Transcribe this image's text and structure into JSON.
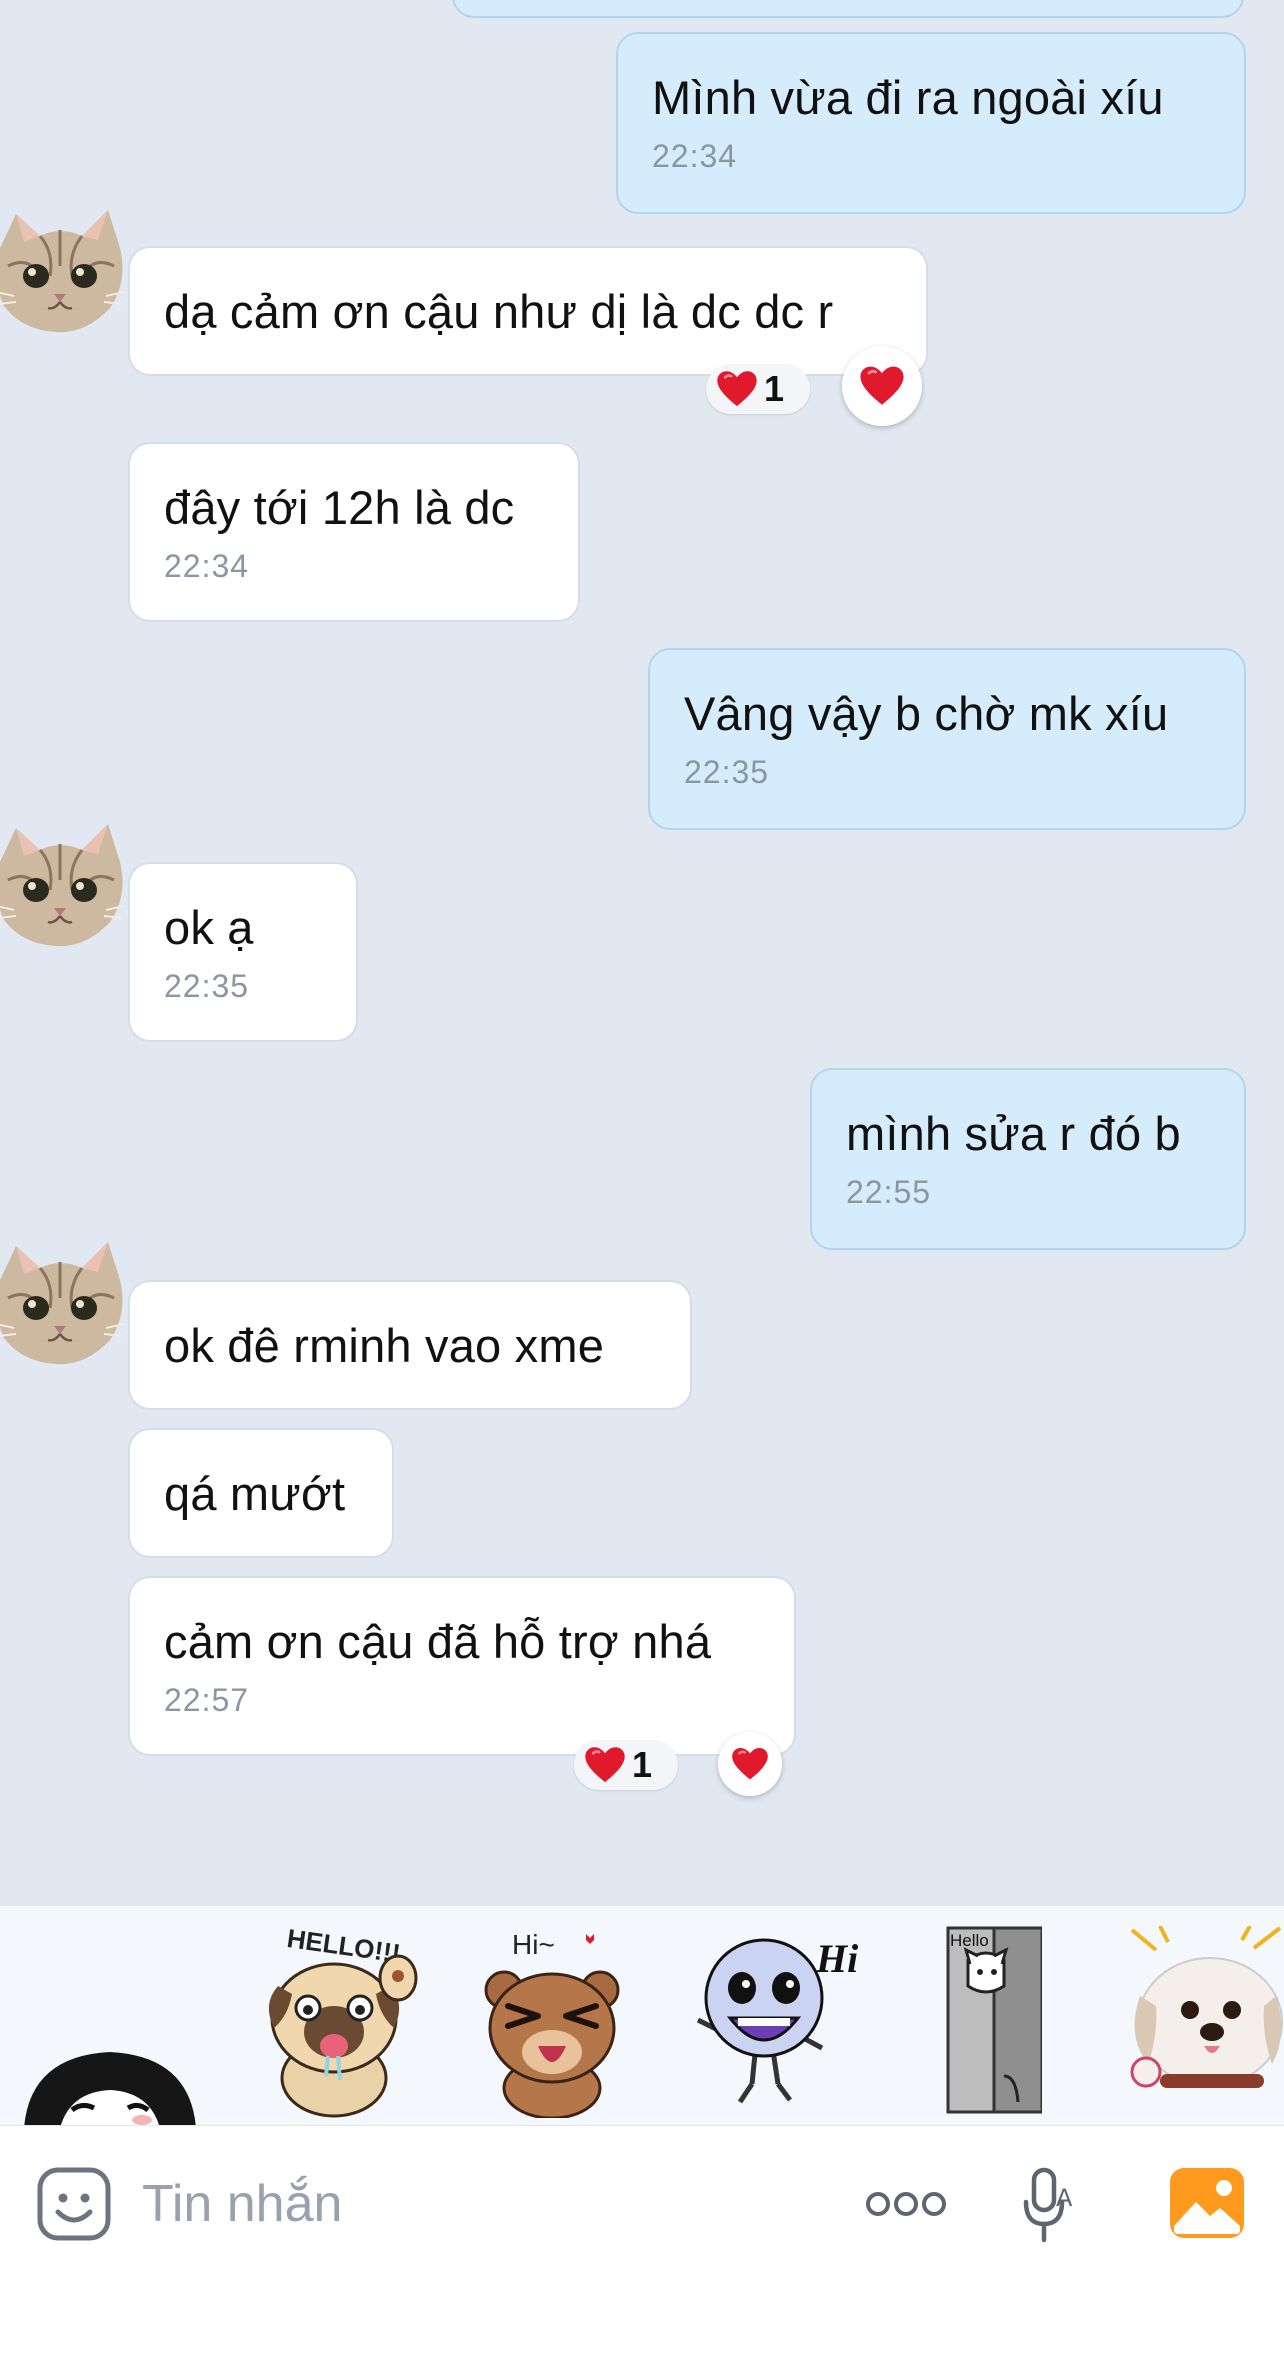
{
  "messages": [
    {
      "id": "m1",
      "side": "out",
      "text": "Mình vừa đi ra ngoài xíu",
      "time": "22:34"
    },
    {
      "id": "m2",
      "side": "in",
      "text": "dạ cảm ơn cậu như dị là dc dc r",
      "reaction": {
        "emoji": "heart",
        "count": "1"
      }
    },
    {
      "id": "m3",
      "side": "in",
      "text": "đây tới 12h là dc",
      "time": "22:34"
    },
    {
      "id": "m4",
      "side": "out",
      "text": "Vâng vậy b chờ mk xíu",
      "time": "22:35"
    },
    {
      "id": "m5",
      "side": "in",
      "text": "ok ạ",
      "time": "22:35"
    },
    {
      "id": "m6",
      "side": "out",
      "text": "mình sửa r đó b",
      "time": "22:55"
    },
    {
      "id": "m7",
      "side": "in",
      "text": "ok đê rminh vao xme"
    },
    {
      "id": "m8",
      "side": "in",
      "text": "qá mướt"
    },
    {
      "id": "m9",
      "side": "in",
      "text": "cảm ơn cậu đã hỗ trợ nhá",
      "time": "22:57",
      "reaction": {
        "emoji": "heart",
        "count": "1"
      }
    }
  ],
  "stickers": [
    {
      "name": "girl-face-sticker"
    },
    {
      "name": "pug-hello-sticker",
      "caption": "HELLO!!!"
    },
    {
      "name": "bear-hi-sticker",
      "caption": "Hi~"
    },
    {
      "name": "skeleton-hi-sticker",
      "caption": "Hi"
    },
    {
      "name": "cat-door-hello-sticker",
      "caption": "Hello"
    },
    {
      "name": "dog-photo-sticker"
    }
  ],
  "composer": {
    "placeholder": "Tin nhắn",
    "icons": [
      "emoji-icon",
      "more-icon",
      "voice-input-icon",
      "image-icon"
    ]
  },
  "colors": {
    "background": "#e2e8f1",
    "incoming_bubble": "#ffffff",
    "outgoing_bubble": "#d4ecfc",
    "time_text": "#8b96a3",
    "heart": "#e0192d",
    "image_button": "#ff9a1f"
  }
}
